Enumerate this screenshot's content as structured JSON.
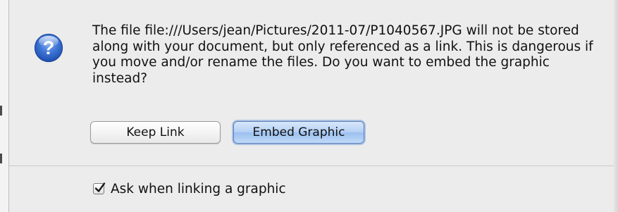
{
  "dialog": {
    "icon": "question-mark-icon",
    "message": "The file file:///Users/jean/Pictures/2011-07/P1040567.JPG will not be stored along with your document, but only referenced as a link. This is dangerous if you move and/or rename the files. Do you want to embed the graphic instead?",
    "buttons": {
      "keep_link": "Keep Link",
      "embed_graphic": "Embed Graphic"
    },
    "checkbox": {
      "label": "Ask when linking a graphic",
      "checked": true
    }
  },
  "colors": {
    "background": "#ececec",
    "default_button": "#b4d0f5",
    "icon_blue": "#2f64c6"
  }
}
